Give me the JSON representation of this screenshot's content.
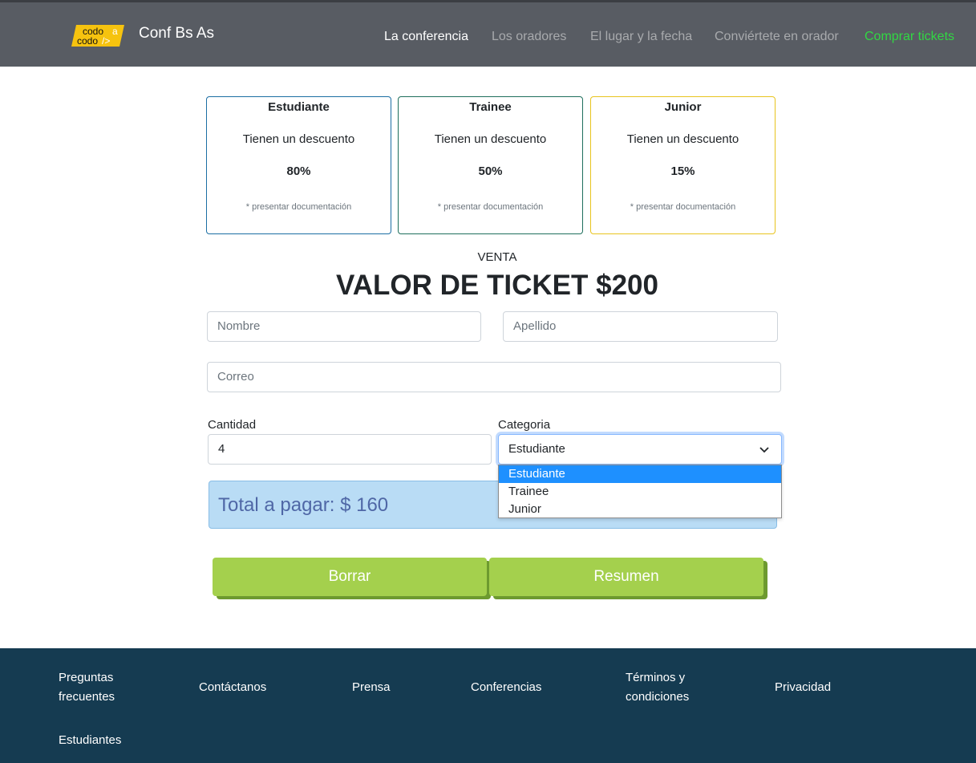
{
  "header": {
    "logo_text_top": "codo",
    "logo_text_a": "a",
    "logo_text_bottom": "codo",
    "logo_text_tag": "/>",
    "brand": "Conf Bs As",
    "nav": [
      {
        "label": "La conferencia",
        "state": "active"
      },
      {
        "label": "Los oradores"
      },
      {
        "label": "El lugar y la fecha"
      },
      {
        "label": "Conviértete en orador"
      },
      {
        "label": "Comprar tickets",
        "state": "highlight"
      }
    ]
  },
  "cards": [
    {
      "title": "Estudiante",
      "description": "Tienen un descuento",
      "discount": "80%",
      "note": "* presentar documentación"
    },
    {
      "title": "Trainee",
      "description": "Tienen un descuento",
      "discount": "50%",
      "note": "* presentar documentación"
    },
    {
      "title": "Junior",
      "description": "Tienen un descuento",
      "discount": "15%",
      "note": "* presentar documentación"
    }
  ],
  "sale": {
    "kicker": "VENTA",
    "title": "VALOR DE TICKET $200"
  },
  "form": {
    "nombre_placeholder": "Nombre",
    "apellido_placeholder": "Apellido",
    "correo_placeholder": "Correo",
    "cantidad_label": "Cantidad",
    "cantidad_value": "4",
    "categoria_label": "Categoria",
    "categoria_value": "Estudiante",
    "categoria_options": [
      "Estudiante",
      "Trainee",
      "Junior"
    ],
    "total": "Total a pagar: $ 160",
    "borrar_label": "Borrar",
    "resumen_label": "Resumen"
  },
  "footer": {
    "links": [
      "Preguntas frecuentes",
      "Contáctanos",
      "Prensa",
      "Conferencias",
      "Términos y condiciones",
      "Privacidad",
      "Estudiantes"
    ]
  },
  "colors": {
    "navbar": "#585c63",
    "buy_link": "#31d843",
    "button": "#a4d04d",
    "footer": "#153b51",
    "total_bg": "#b9dcf5"
  }
}
